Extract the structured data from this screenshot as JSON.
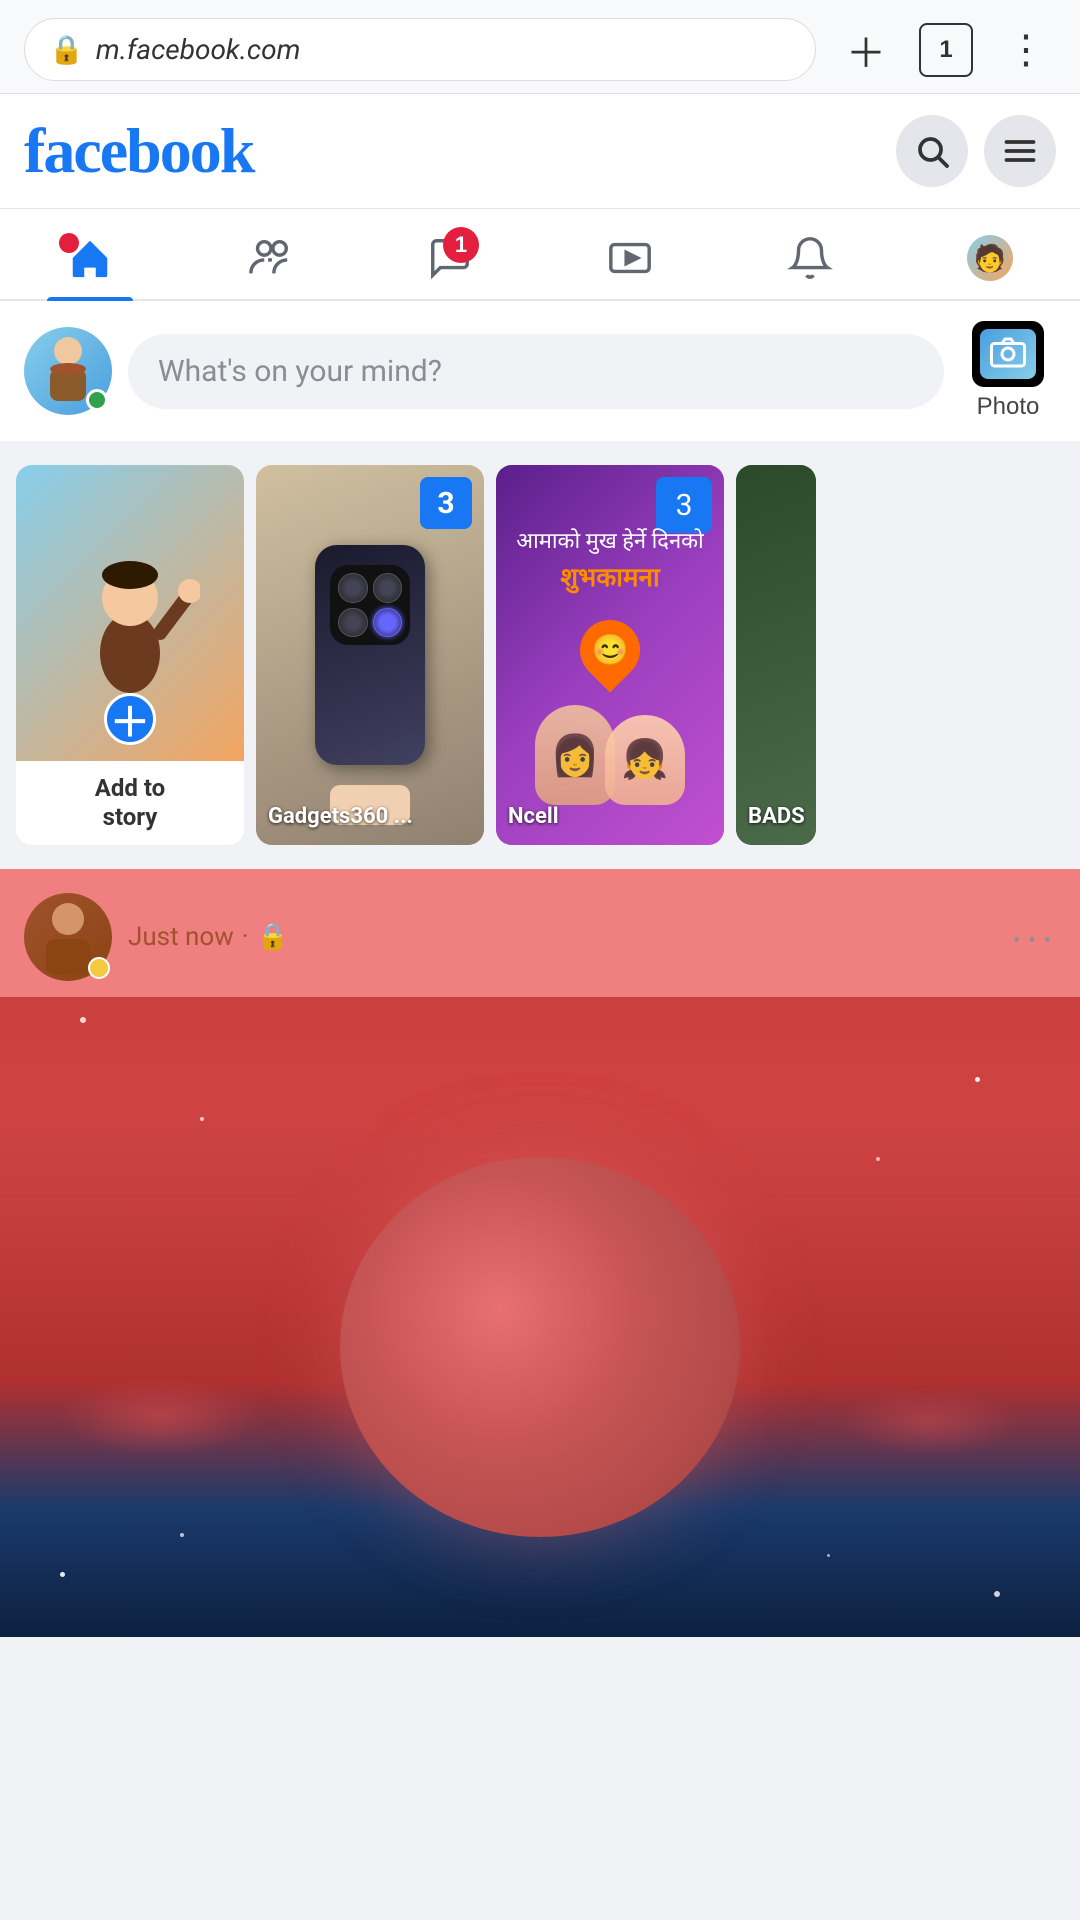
{
  "browser": {
    "url": "m.facebook.com",
    "tab_count": "1",
    "lock_icon": "🔒"
  },
  "header": {
    "logo": "facebook",
    "search_label": "Search",
    "menu_label": "Menu"
  },
  "nav": {
    "items": [
      {
        "id": "home",
        "label": "Home",
        "active": true
      },
      {
        "id": "friends",
        "label": "Friends",
        "active": false
      },
      {
        "id": "messenger",
        "label": "Messenger",
        "active": false,
        "badge": "1"
      },
      {
        "id": "watch",
        "label": "Watch",
        "active": false
      },
      {
        "id": "notifications",
        "label": "Notifications",
        "active": false
      },
      {
        "id": "menu",
        "label": "Menu",
        "active": false
      }
    ]
  },
  "post_input": {
    "placeholder": "What's on your mind?",
    "photo_label": "Photo"
  },
  "stories": [
    {
      "id": "add",
      "label": "Add to story",
      "type": "add"
    },
    {
      "id": "gadgets360",
      "label": "Gadgets360 ...",
      "count": "3",
      "type": "phone"
    },
    {
      "id": "ncell",
      "label": "Ncell",
      "count": "3",
      "type": "ncell"
    },
    {
      "id": "bads",
      "label": "BADS",
      "type": "bads"
    }
  ],
  "post": {
    "time": "Just now",
    "privacy": "🔒",
    "more_icon": "···"
  }
}
